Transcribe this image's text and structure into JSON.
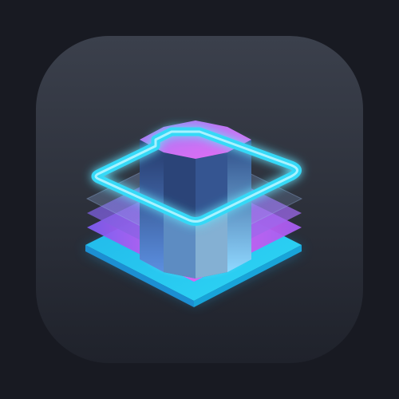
{
  "icon": {
    "name": "layered-stack-app-icon",
    "tile_gradient": [
      "#3a3f4b",
      "#20232c"
    ],
    "background_color": "#181a22",
    "accent_colors": {
      "cyan": "#2fd6f5",
      "magenta": "#e056f2",
      "violet": "#8a5cf0",
      "navy": "#2c3f7a"
    }
  }
}
